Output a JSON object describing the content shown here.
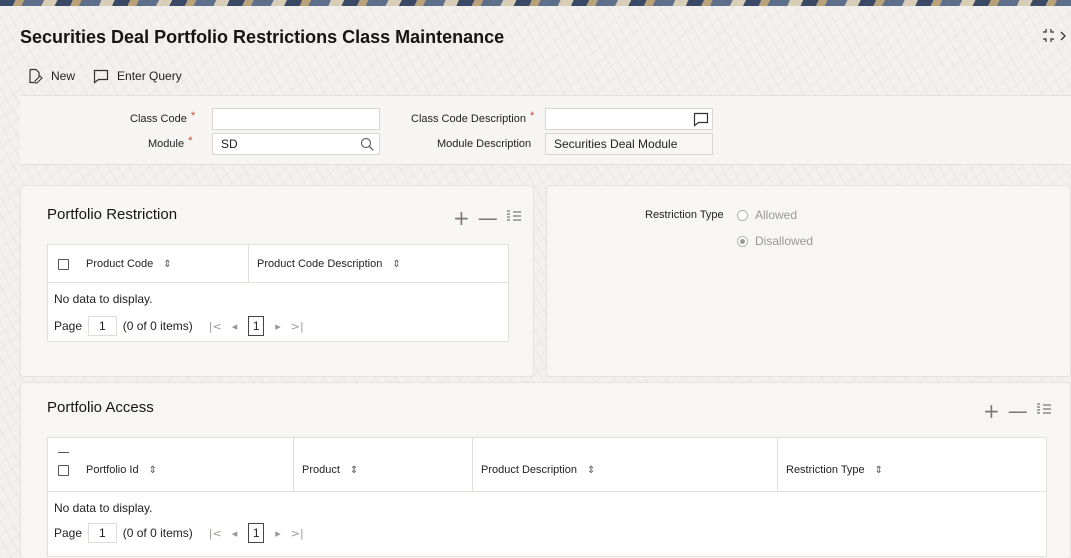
{
  "page": {
    "title": "Securities Deal Portfolio Restrictions Class Maintenance"
  },
  "toolbar": {
    "new_label": "New",
    "enter_query_label": "Enter Query"
  },
  "form": {
    "class_code_label": "Class Code",
    "class_code_value": "",
    "class_code_desc_label": "Class Code Description",
    "class_code_desc_value": "",
    "module_label": "Module",
    "module_value": "SD",
    "module_desc_label": "Module Description",
    "module_desc_value": "Securities Deal Module",
    "required_mark": "*"
  },
  "portfolio_restriction": {
    "title": "Portfolio Restriction",
    "columns": [
      "Product Code",
      "Product Code Description"
    ],
    "rows": [],
    "empty_text": "No data to display.",
    "pager": {
      "page_label": "Page",
      "page_input": "1",
      "items_text": "(0 of 0 items)",
      "current_page": "1"
    }
  },
  "restriction_type": {
    "label": "Restriction Type",
    "options": [
      "Allowed",
      "Disallowed"
    ],
    "selected": "Disallowed"
  },
  "portfolio_access": {
    "title": "Portfolio Access",
    "columns": [
      "Portfolio Id",
      "Product",
      "Product Description",
      "Restriction Type"
    ],
    "rows": [],
    "empty_text": "No data to display.",
    "pager": {
      "page_label": "Page",
      "page_input": "1",
      "items_text": "(0 of 0 items)",
      "current_page": "1"
    }
  },
  "icons": {
    "new": "new-document-icon",
    "enter_query": "comment-icon",
    "search": "search-icon",
    "description_popup": "comment-icon",
    "expand": "expand-icon",
    "add_row": "plus-icon",
    "delete_row": "minus-icon",
    "column_manage": "list-icon"
  },
  "colors": {
    "required": "#c74634",
    "disabled_text": "#9a9894"
  }
}
